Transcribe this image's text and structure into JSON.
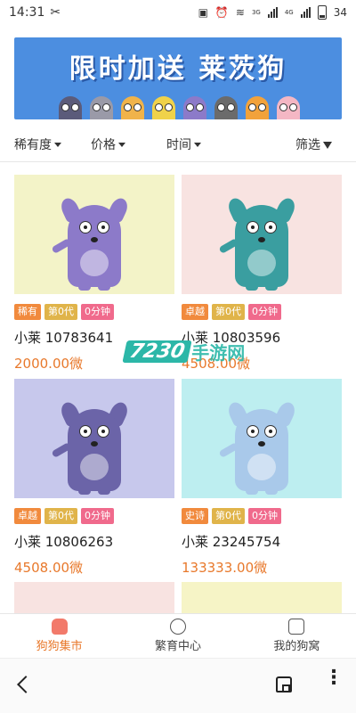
{
  "status_bar": {
    "time": "14:31",
    "signal_3g": "3G",
    "signal_4g": "4G",
    "battery": "34"
  },
  "banner": {
    "title": "限时加送 莱茨狗"
  },
  "filters": [
    {
      "label": "稀有度"
    },
    {
      "label": "价格"
    },
    {
      "label": "时间"
    },
    {
      "label": "筛选"
    }
  ],
  "cards": [
    {
      "name": "小莱 10783641",
      "price": "2000.00微",
      "bg": "#f3f3c8",
      "color": "#8c7ac9",
      "tags": [
        {
          "label": "稀有",
          "color": "#f18a3d"
        },
        {
          "label": "第0代",
          "color": "#e0b44a"
        },
        {
          "label": "0分钟",
          "color": "#f06a8c"
        }
      ]
    },
    {
      "name": "小莱 10803596",
      "price": "4508.00微",
      "bg": "#f8e3e1",
      "color": "#3a9ea0",
      "tags": [
        {
          "label": "卓越",
          "color": "#f18a3d"
        },
        {
          "label": "第0代",
          "color": "#e0b44a"
        },
        {
          "label": "0分钟",
          "color": "#f06a8c"
        }
      ]
    },
    {
      "name": "小莱 10806263",
      "price": "4508.00微",
      "bg": "#c7c8ec",
      "color": "#6b64a8",
      "tags": [
        {
          "label": "卓越",
          "color": "#f18a3d"
        },
        {
          "label": "第0代",
          "color": "#e0b44a"
        },
        {
          "label": "0分钟",
          "color": "#f06a8c"
        }
      ]
    },
    {
      "name": "小莱 23245754",
      "price": "133333.00微",
      "bg": "#bdeef0",
      "color": "#a9c9ea",
      "tags": [
        {
          "label": "史诗",
          "color": "#f18a3d"
        },
        {
          "label": "第0代",
          "color": "#e0b44a"
        },
        {
          "label": "0分钟",
          "color": "#f06a8c"
        }
      ]
    }
  ],
  "partial_cards": [
    {
      "bg": "#f8e3e1"
    },
    {
      "bg": "#f6f4c6"
    }
  ],
  "watermark": {
    "number": "7230",
    "text": "手游网"
  },
  "tabbar": [
    {
      "label": "狗狗集市",
      "icon": "dog-house-icon",
      "active": true
    },
    {
      "label": "繁育中心",
      "icon": "egg-icon",
      "active": false
    },
    {
      "label": "我的狗窝",
      "icon": "profile-icon",
      "active": false
    }
  ],
  "navbar": {
    "back": "back-icon",
    "home": "home-icon",
    "menu": "more-icon",
    "menu_glyph": "⋮"
  }
}
